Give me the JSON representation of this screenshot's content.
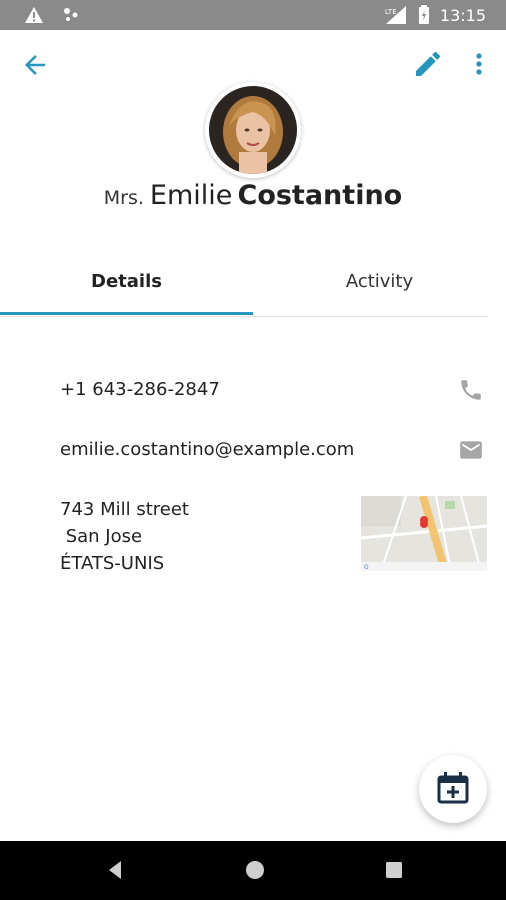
{
  "status_bar": {
    "time": "13:15",
    "network": "LTE"
  },
  "header": {
    "back_icon": "arrow-back-icon",
    "edit_icon": "pencil-icon",
    "more_icon": "more-vert-icon",
    "accent_color": "#2596be"
  },
  "contact": {
    "title": "Mrs.",
    "first_name": "Emilie",
    "last_name": "Costantino"
  },
  "tabs": [
    {
      "label": "Details",
      "active": true
    },
    {
      "label": "Activity",
      "active": false
    }
  ],
  "details": {
    "phone": "+1 643-286-2847",
    "email": "emilie.costantino@example.com",
    "address": {
      "street": "743 Mill street",
      "city": " San Jose",
      "country": "ÉTATS-UNIS"
    }
  },
  "fab": {
    "icon": "calendar-add-icon"
  }
}
